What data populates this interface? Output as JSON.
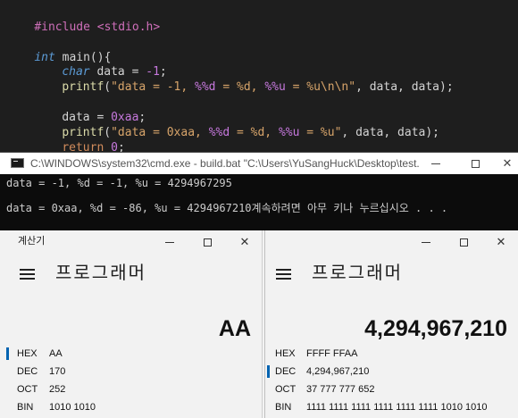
{
  "editor": {
    "lines": {
      "l1": "#include <stdio.h>",
      "l3_kw": "int",
      "l3_rest": " main(){",
      "l4_kw": "char",
      "l4_rest": " data = ",
      "l4_num": "-1",
      "l4_end": ";",
      "l5_fn": "printf",
      "l5_open": "(",
      "l5_s1": "\"data = -1, ",
      "l5_f1": "%%d",
      "l5_s2": " = %d, ",
      "l5_f2": "%%u",
      "l5_s3": " = %u\\n\\n\"",
      "l5_end": ", data, data);",
      "l7_rest": "data = ",
      "l7_num": "0xaa",
      "l7_end": ";",
      "l8_fn": "printf",
      "l8_open": "(",
      "l8_s1": "\"data = 0xaa, ",
      "l8_f1": "%%d",
      "l8_s2": " = %d, ",
      "l8_f2": "%%u",
      "l8_s3": " = %u\"",
      "l8_end": ", data, data);",
      "l9_kw": "return",
      "l9_num": " 0",
      "l9_end": ";",
      "l10": "}"
    }
  },
  "console": {
    "title": "C:\\WINDOWS\\system32\\cmd.exe - build.bat   \"C:\\Users\\YuSangHuck\\Desktop\\test...",
    "output_line1": "data = -1, %d = -1, %u = 4294967295",
    "output_line2": "data = 0xaa, %d = -86, %u = 4294967210계속하려면 아무 키나 누르십시오 . . .",
    "icon": "console-icon"
  },
  "window_controls": {
    "minimize": "minimize-icon",
    "maximize": "maximize-icon",
    "close": "✕"
  },
  "calc_left": {
    "title": "계산기",
    "mode": "프로그래머",
    "display": "AA",
    "bases": [
      {
        "label": "HEX",
        "value": "AA"
      },
      {
        "label": "DEC",
        "value": "170"
      },
      {
        "label": "OCT",
        "value": "252"
      },
      {
        "label": "BIN",
        "value": "1010 1010"
      }
    ],
    "selected_base": "HEX"
  },
  "calc_right": {
    "mode": "프로그래머",
    "display": "4,294,967,210",
    "bases": [
      {
        "label": "HEX",
        "value": "FFFF FFAA"
      },
      {
        "label": "DEC",
        "value": "4,294,967,210"
      },
      {
        "label": "OCT",
        "value": "37 777 777 652"
      },
      {
        "label": "BIN",
        "value": "1111 1111 1111 1111 1111 1111 1010 1010"
      }
    ],
    "selected_base": "DEC"
  },
  "colors": {
    "accent": "#0063b1",
    "editor_bg": "#1e1e1e",
    "console_bg": "#0c0c0c"
  }
}
